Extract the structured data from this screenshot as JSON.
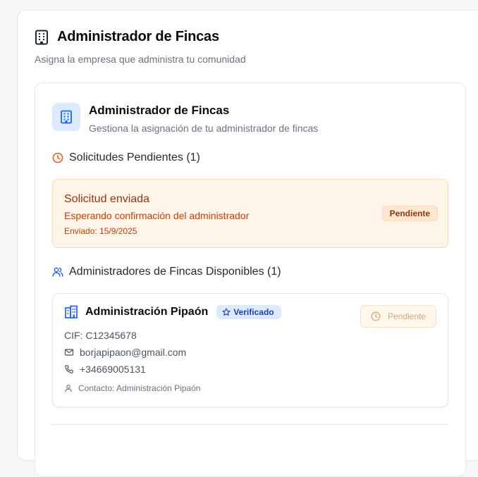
{
  "colors": {
    "accent_blue": "#2563eb",
    "pending_orange": "#ea580c",
    "pending_bg": "#fff4e8",
    "verified_bg": "#dbeafe"
  },
  "header": {
    "icon": "building-icon",
    "title": "Administrador de Fincas",
    "subtitle": "Asigna la empresa que administra tu comunidad"
  },
  "card": {
    "icon": "building-icon",
    "title": "Administrador de Fincas",
    "subtitle": "Gestiona la asignación de tu administrador de fincas"
  },
  "pending_section": {
    "icon": "clock-icon",
    "heading": "Solicitudes Pendientes (1)",
    "request": {
      "title": "Solicitud enviada",
      "description": "Esperando confirmación del administrador",
      "date": "Enviado: 15/9/2025",
      "badge": "Pendiente"
    }
  },
  "available_section": {
    "icon": "users-icon",
    "heading": "Administradores de Fincas Disponibles (1)",
    "admins": [
      {
        "icon": "building-icon",
        "name": "Administración Pipaón",
        "verified_label": "Verificado",
        "cif": "CIF: C12345678",
        "email": "borjapipaon@gmail.com",
        "phone": "+34669005131",
        "contact": "Contacto: Administración Pipaón",
        "action_label": "Pendiente"
      }
    ]
  }
}
